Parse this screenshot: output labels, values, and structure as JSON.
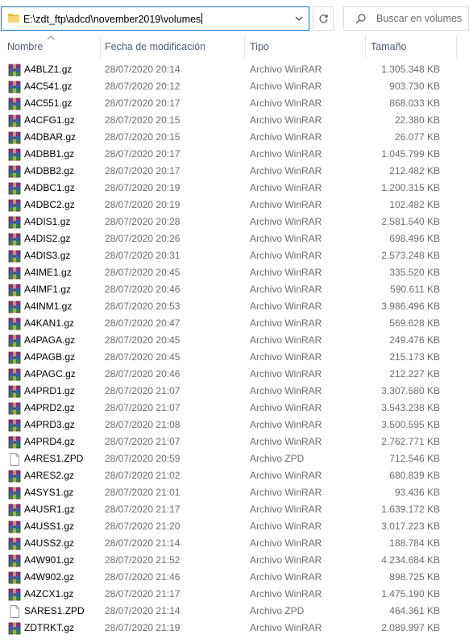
{
  "address": {
    "path": "E:\\zdt_ftp\\adcd\\november2019\\volumes"
  },
  "search": {
    "placeholder": "Buscar en volumes"
  },
  "columns": {
    "name": "Nombre",
    "date": "Fecha de modificación",
    "type": "Tipo",
    "size": "Tamaño"
  },
  "colors": {
    "accent": "#0078d7",
    "header_text": "#4c607a",
    "secondary_text": "#6d6d6d"
  },
  "icons": {
    "rar": "winrar-archive-icon",
    "zpd": "blank-document-icon"
  },
  "files": [
    {
      "name": "A4BLZ1.gz",
      "date": "28/07/2020 20:14",
      "type": "Archivo WinRAR",
      "size": "1.305.348 KB",
      "icon": "rar"
    },
    {
      "name": "A4C541.gz",
      "date": "28/07/2020 20:12",
      "type": "Archivo WinRAR",
      "size": "903.730 KB",
      "icon": "rar"
    },
    {
      "name": "A4C551.gz",
      "date": "28/07/2020 20:17",
      "type": "Archivo WinRAR",
      "size": "868.033 KB",
      "icon": "rar"
    },
    {
      "name": "A4CFG1.gz",
      "date": "28/07/2020 20:15",
      "type": "Archivo WinRAR",
      "size": "22.380 KB",
      "icon": "rar"
    },
    {
      "name": "A4DBAR.gz",
      "date": "28/07/2020 20:15",
      "type": "Archivo WinRAR",
      "size": "26.077 KB",
      "icon": "rar"
    },
    {
      "name": "A4DBB1.gz",
      "date": "28/07/2020 20:17",
      "type": "Archivo WinRAR",
      "size": "1.045.799 KB",
      "icon": "rar"
    },
    {
      "name": "A4DBB2.gz",
      "date": "28/07/2020 20:17",
      "type": "Archivo WinRAR",
      "size": "212.482 KB",
      "icon": "rar"
    },
    {
      "name": "A4DBC1.gz",
      "date": "28/07/2020 20:19",
      "type": "Archivo WinRAR",
      "size": "1.200.315 KB",
      "icon": "rar"
    },
    {
      "name": "A4DBC2.gz",
      "date": "28/07/2020 20:19",
      "type": "Archivo WinRAR",
      "size": "102.482 KB",
      "icon": "rar"
    },
    {
      "name": "A4DIS1.gz",
      "date": "28/07/2020 20:28",
      "type": "Archivo WinRAR",
      "size": "2.581.540 KB",
      "icon": "rar"
    },
    {
      "name": "A4DIS2.gz",
      "date": "28/07/2020 20:26",
      "type": "Archivo WinRAR",
      "size": "698.496 KB",
      "icon": "rar"
    },
    {
      "name": "A4DIS3.gz",
      "date": "28/07/2020 20:31",
      "type": "Archivo WinRAR",
      "size": "2.573.248 KB",
      "icon": "rar"
    },
    {
      "name": "A4IME1.gz",
      "date": "28/07/2020 20:45",
      "type": "Archivo WinRAR",
      "size": "335.520 KB",
      "icon": "rar"
    },
    {
      "name": "A4IMF1.gz",
      "date": "28/07/2020 20:46",
      "type": "Archivo WinRAR",
      "size": "590.611 KB",
      "icon": "rar"
    },
    {
      "name": "A4INM1.gz",
      "date": "28/07/2020 20:53",
      "type": "Archivo WinRAR",
      "size": "3.986.496 KB",
      "icon": "rar"
    },
    {
      "name": "A4KAN1.gz",
      "date": "28/07/2020 20:47",
      "type": "Archivo WinRAR",
      "size": "569.628 KB",
      "icon": "rar"
    },
    {
      "name": "A4PAGA.gz",
      "date": "28/07/2020 20:45",
      "type": "Archivo WinRAR",
      "size": "249.476 KB",
      "icon": "rar"
    },
    {
      "name": "A4PAGB.gz",
      "date": "28/07/2020 20:45",
      "type": "Archivo WinRAR",
      "size": "215.173 KB",
      "icon": "rar"
    },
    {
      "name": "A4PAGC.gz",
      "date": "28/07/2020 20:46",
      "type": "Archivo WinRAR",
      "size": "212.227 KB",
      "icon": "rar"
    },
    {
      "name": "A4PRD1.gz",
      "date": "28/07/2020 21:07",
      "type": "Archivo WinRAR",
      "size": "3.307.580 KB",
      "icon": "rar"
    },
    {
      "name": "A4PRD2.gz",
      "date": "28/07/2020 21:07",
      "type": "Archivo WinRAR",
      "size": "3.543.238 KB",
      "icon": "rar"
    },
    {
      "name": "A4PRD3.gz",
      "date": "28/07/2020 21:08",
      "type": "Archivo WinRAR",
      "size": "3.500.595 KB",
      "icon": "rar"
    },
    {
      "name": "A4PRD4.gz",
      "date": "28/07/2020 21:07",
      "type": "Archivo WinRAR",
      "size": "2.762.771 KB",
      "icon": "rar"
    },
    {
      "name": "A4RES1.ZPD",
      "date": "28/07/2020 20:59",
      "type": "Archivo ZPD",
      "size": "712.546 KB",
      "icon": "zpd"
    },
    {
      "name": "A4RES2.gz",
      "date": "28/07/2020 21:02",
      "type": "Archivo WinRAR",
      "size": "680.839 KB",
      "icon": "rar"
    },
    {
      "name": "A4SYS1.gz",
      "date": "28/07/2020 21:01",
      "type": "Archivo WinRAR",
      "size": "93.436 KB",
      "icon": "rar"
    },
    {
      "name": "A4USR1.gz",
      "date": "28/07/2020 21:17",
      "type": "Archivo WinRAR",
      "size": "1.639.172 KB",
      "icon": "rar"
    },
    {
      "name": "A4USS1.gz",
      "date": "28/07/2020 21:20",
      "type": "Archivo WinRAR",
      "size": "3.017.223 KB",
      "icon": "rar"
    },
    {
      "name": "A4USS2.gz",
      "date": "28/07/2020 21:14",
      "type": "Archivo WinRAR",
      "size": "188.784 KB",
      "icon": "rar"
    },
    {
      "name": "A4W901.gz",
      "date": "28/07/2020 21:52",
      "type": "Archivo WinRAR",
      "size": "4.234.684 KB",
      "icon": "rar"
    },
    {
      "name": "A4W902.gz",
      "date": "28/07/2020 21:46",
      "type": "Archivo WinRAR",
      "size": "898.725 KB",
      "icon": "rar"
    },
    {
      "name": "A4ZCX1.gz",
      "date": "28/07/2020 21:17",
      "type": "Archivo WinRAR",
      "size": "1.475.190 KB",
      "icon": "rar"
    },
    {
      "name": "SARES1.ZPD",
      "date": "28/07/2020 21:14",
      "type": "Archivo ZPD",
      "size": "464.361 KB",
      "icon": "zpd"
    },
    {
      "name": "ZDTRKT.gz",
      "date": "28/07/2020 21:19",
      "type": "Archivo WinRAR",
      "size": "2.089.997 KB",
      "icon": "rar"
    }
  ]
}
